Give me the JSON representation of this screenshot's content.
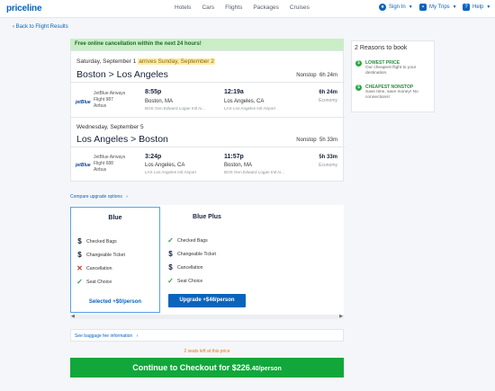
{
  "header": {
    "logo": "priceline",
    "nav": [
      "Hotels",
      "Cars",
      "Flights",
      "Packages",
      "Cruises"
    ],
    "sign_in": "Sign In",
    "my_trips": "My Trips",
    "help": "Help"
  },
  "back_link": "‹ Back to Flight Results",
  "banner": "Free online cancellation within the next 24 hours!",
  "outbound": {
    "date": "Saturday, September 1",
    "arrives_note": "arrives Sunday, September 2",
    "route": "Boston > Los Angeles",
    "stops": "Nonstop",
    "total_duration": "6h 24m",
    "airline_logo": "jetBlue",
    "airline": "JetBlue Airways",
    "flight": "Flight 987",
    "aircraft": "Airbus",
    "depart_time": "8:55p",
    "depart_city": "Boston, MA",
    "depart_airport": "BOS Gen Edward Logan Intl Ai...",
    "arrive_time": "12:19a",
    "arrive_city": "Los Angeles, CA",
    "arrive_airport": "LAX Los Angeles Intl Airport",
    "duration": "6h 24m",
    "cabin": "Economy"
  },
  "return": {
    "date": "Wednesday, September 5",
    "route": "Los Angeles > Boston",
    "stops": "Nonstop",
    "total_duration": "5h 33m",
    "airline_logo": "jetBlue",
    "airline": "JetBlue Airways",
    "flight": "Flight 688",
    "aircraft": "Airbus",
    "depart_time": "3:24p",
    "depart_city": "Los Angeles, CA",
    "depart_airport": "LAX Los Angeles Intl Airport",
    "arrive_time": "11:57p",
    "arrive_city": "Boston, MA",
    "arrive_airport": "BOS Gen Edward Logan Intl Ai...",
    "duration": "5h 33m",
    "cabin": "Economy"
  },
  "reasons": {
    "title": "2 Reasons to book",
    "items": [
      {
        "heading": "LOWEST PRICE",
        "text": "Our cheapest flight to your destination."
      },
      {
        "heading": "CHEAPEST NONSTOP",
        "text": "Save time, save money! No connections!"
      }
    ]
  },
  "compare_link": "Compare upgrade options",
  "fares": [
    {
      "name": "Blue",
      "features": [
        "Checked Bags",
        "Changeable Ticket",
        "Cancellation",
        "Seat Choice"
      ],
      "marks": [
        "fee",
        "fee",
        "no",
        "ok"
      ],
      "action": "Selected +$0/person"
    },
    {
      "name": "Blue Plus",
      "features": [
        "Checked Bags",
        "Changeable Ticket",
        "Cancellation",
        "Seat Choice"
      ],
      "marks": [
        "ok",
        "fee",
        "fee",
        "ok"
      ],
      "action": "Upgrade +$46/person"
    }
  ],
  "baggage_link": "See baggage fee information",
  "seats_left": "2 seats left at this price",
  "checkout": {
    "label": "Continue to Checkout for $226",
    "cents": ".40/person"
  },
  "colors": {
    "brand": "#0a64bc",
    "banner_bg": "#c9eec6",
    "checkout": "#11a73b",
    "warning": "#e5771e"
  }
}
